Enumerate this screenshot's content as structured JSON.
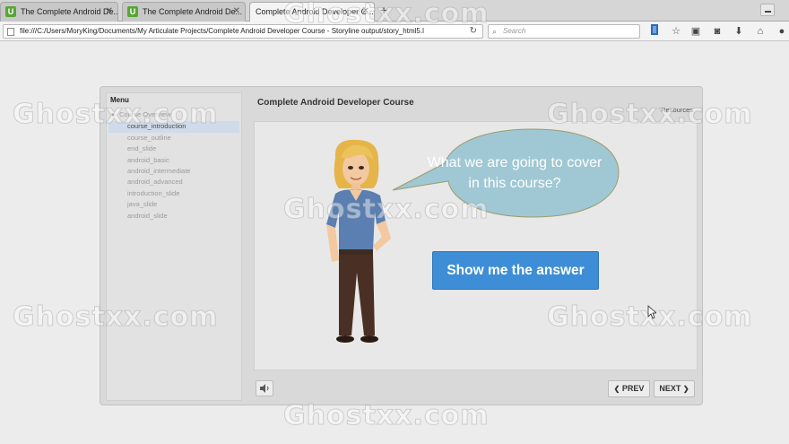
{
  "browser": {
    "tabs": [
      {
        "label": "The Complete Android De...",
        "active": false
      },
      {
        "label": "The Complete Android De...",
        "active": false,
        "icon": "U"
      },
      {
        "label": "Complete Android Developer C...",
        "active": true
      }
    ],
    "url": "file:///C:/Users/MoryKing/Documents/My Articulate Projects/Complete Android Developer Course - Storyline output/story_html5.l",
    "search_placeholder": "Search"
  },
  "player": {
    "menu_title": "Menu",
    "menu": [
      {
        "label": "Course Overview",
        "group": true
      },
      {
        "label": "course_introduction",
        "selected": true
      },
      {
        "label": "course_outline"
      },
      {
        "label": "end_slide"
      },
      {
        "label": "android_basic"
      },
      {
        "label": "android_intermediate"
      },
      {
        "label": "android_advanced"
      },
      {
        "label": "introduction_slide"
      },
      {
        "label": "java_slide"
      },
      {
        "label": "android_slide"
      }
    ],
    "course_title": "Complete Android Developer Course",
    "resources_label": "Resources",
    "slide": {
      "question": "What we  are going to cover in this course?",
      "answer_button": "Show me the answer"
    },
    "nav": {
      "prev": "PREV",
      "next": "NEXT"
    }
  },
  "watermark": "Ghostxx.com",
  "colors": {
    "accent_button": "#3d8ed6",
    "bubble": "#9fc8d4",
    "menu_selected": "#cfdbe8"
  }
}
